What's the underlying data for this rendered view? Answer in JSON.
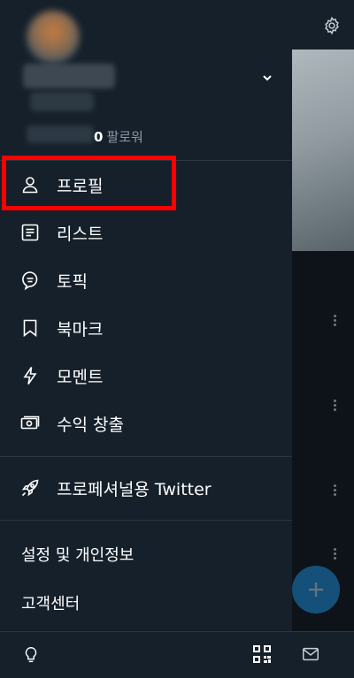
{
  "background": {
    "settings_icon": "gear-icon",
    "compose_icon": "plus-icon",
    "messages_icon": "mail-icon"
  },
  "account": {
    "followers_count": "0",
    "followers_label": "팔로워",
    "switcher_icon": "chevron-down-icon"
  },
  "menu": {
    "items": [
      {
        "label": "프로필",
        "icon": "person-icon"
      },
      {
        "label": "리스트",
        "icon": "list-icon"
      },
      {
        "label": "토픽",
        "icon": "topic-icon"
      },
      {
        "label": "북마크",
        "icon": "bookmark-icon"
      },
      {
        "label": "모멘트",
        "icon": "lightning-icon"
      },
      {
        "label": "수익 창출",
        "icon": "money-icon"
      }
    ],
    "professional": {
      "label": "프로페셔널용 Twitter",
      "icon": "rocket-icon"
    },
    "settings_label": "설정 및 개인정보",
    "help_label": "고객센터"
  },
  "footer": {
    "theme_icon": "lightbulb-icon",
    "qr_icon": "qr-code-icon"
  },
  "colors": {
    "background": "#15202b",
    "text": "#ffffff",
    "secondary_text": "#8b98a5",
    "highlight": "#ff0000",
    "accent": "#1d9bf0"
  }
}
